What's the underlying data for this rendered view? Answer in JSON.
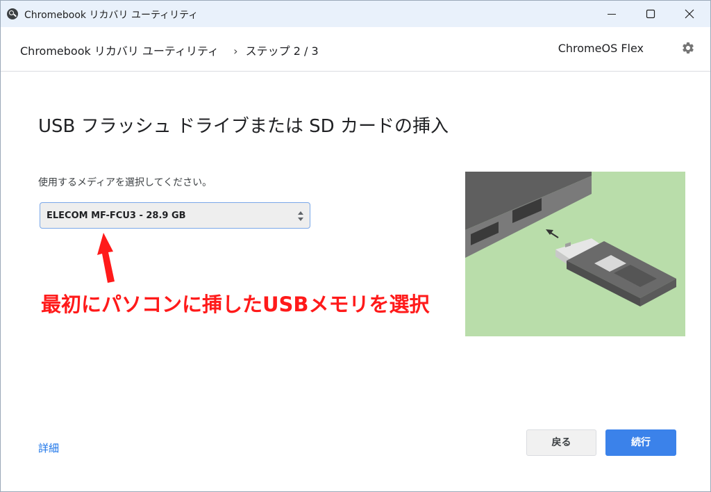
{
  "window": {
    "title": "Chromebook リカバリ ユーティリティ"
  },
  "header": {
    "app_name": "Chromebook リカバリ ユーティリティ",
    "separator": "›",
    "step": "ステップ 2 / 3",
    "product": "ChromeOS Flex"
  },
  "main": {
    "title": "USB フラッシュ ドライブまたは SD カードの挿入",
    "instruction": "使用するメディアを選択してください。",
    "media_select": {
      "selected": "ELECOM MF-FCU3 - 28.9 GB"
    },
    "annotation": "最初にパソコンに挿したUSBメモリを選択"
  },
  "footer": {
    "details_link": "詳細",
    "back_label": "戻る",
    "next_label": "続行"
  },
  "colors": {
    "accent": "#3b82ea",
    "link": "#1a73e8",
    "annotation": "#ff1a1a",
    "titlebar": "#e9f1fb",
    "illustration_bg": "#b9ddaa"
  },
  "icons": {
    "app": "recovery-app-icon",
    "settings": "gear-icon",
    "select": "up-down-arrows-icon"
  }
}
